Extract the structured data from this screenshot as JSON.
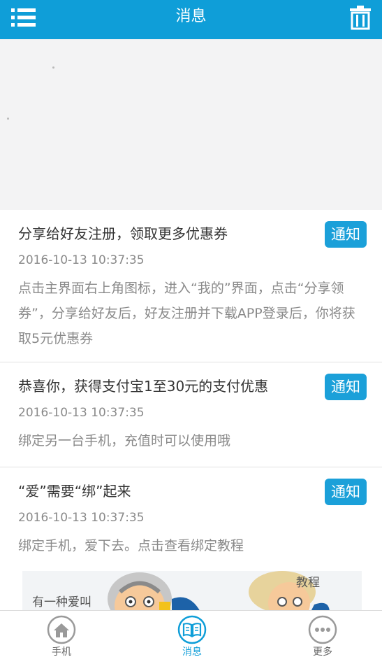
{
  "header": {
    "title": "消息",
    "menu_icon": "menu-icon",
    "delete_icon": "trash-icon",
    "color": "#0f9ed8"
  },
  "messages": [
    {
      "title": "分享给好友注册，领取更多优惠券",
      "badge": "通知",
      "time": "2016-10-13 10:37:35",
      "body": "点击主界面右上角图标，进入“我的”界面，点击“分享领券”，分享给好友后，好友注册并下载APP登录后，你将获取5元优惠券"
    },
    {
      "title": "恭喜你，获得支付宝1至30元的支付优惠",
      "badge": "通知",
      "time": "2016-10-13 10:37:35",
      "body": "绑定另一台手机，充值时可以使用哦"
    },
    {
      "title": "“爱”需要“绑”起来",
      "badge": "通知",
      "time": "2016-10-13 10:37:35",
      "body": "绑定手机，爱下去。点击查看绑定教程"
    }
  ],
  "ad": {
    "text_left": "有一种爱叫",
    "text_right": "教程"
  },
  "bottom_nav": [
    {
      "label": "手机",
      "icon": "home-icon",
      "active": false
    },
    {
      "label": "消息",
      "icon": "book-icon",
      "active": true
    },
    {
      "label": "更多",
      "icon": "more-icon",
      "active": false
    }
  ]
}
